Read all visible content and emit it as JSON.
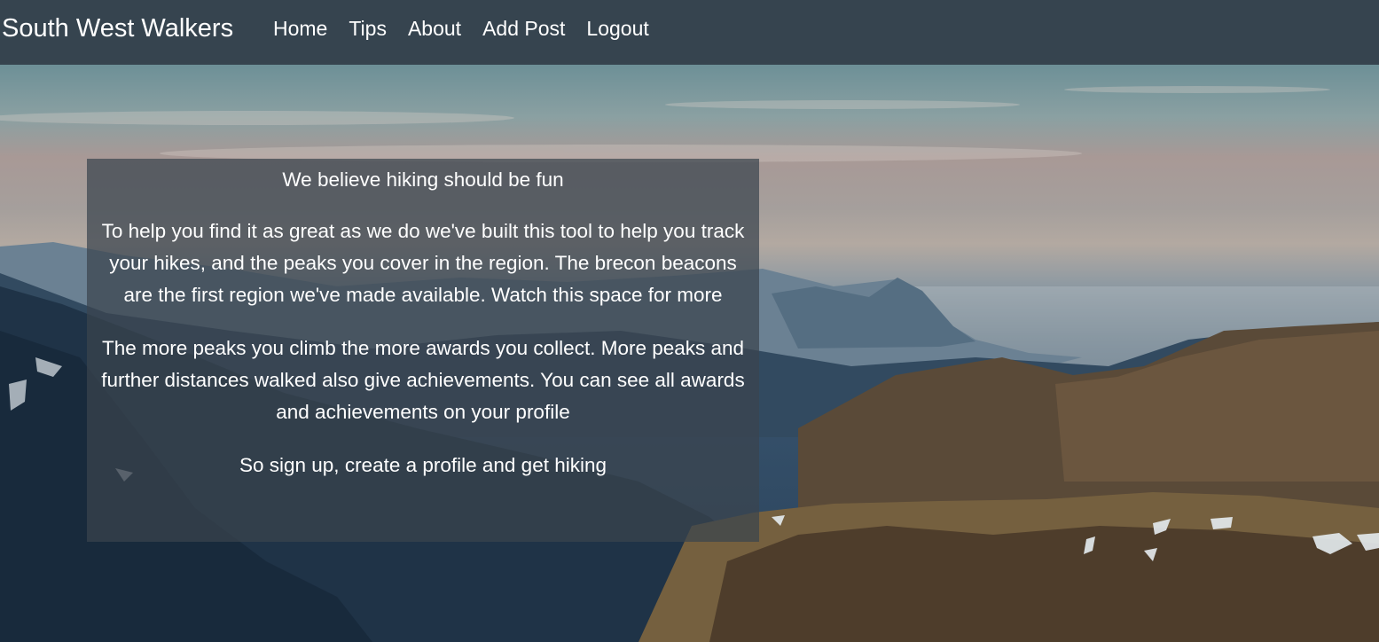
{
  "navbar": {
    "brand": "South West Walkers",
    "links": [
      {
        "label": "Home"
      },
      {
        "label": "Tips"
      },
      {
        "label": "About"
      },
      {
        "label": "Add Post"
      },
      {
        "label": "Logout"
      }
    ]
  },
  "panel": {
    "heading": "We believe hiking should be fun",
    "intro": "To help you find it as great as we do we've built this tool to help you track your hikes, and the peaks you cover in the region. The brecon beacons are the first region we've made available. Watch this space for more",
    "awards": "The more peaks you climb the more awards you collect. More peaks and further distances walked also give achievements. You can see all awards and achievements on your profile",
    "cta": "So sign up, create a profile and get hiking"
  },
  "colors": {
    "navbar_bg": "#36444f",
    "nav_text": "#ffffff",
    "panel_bg": "rgba(58,68,77,0.72)",
    "panel_text": "#ffffff"
  }
}
